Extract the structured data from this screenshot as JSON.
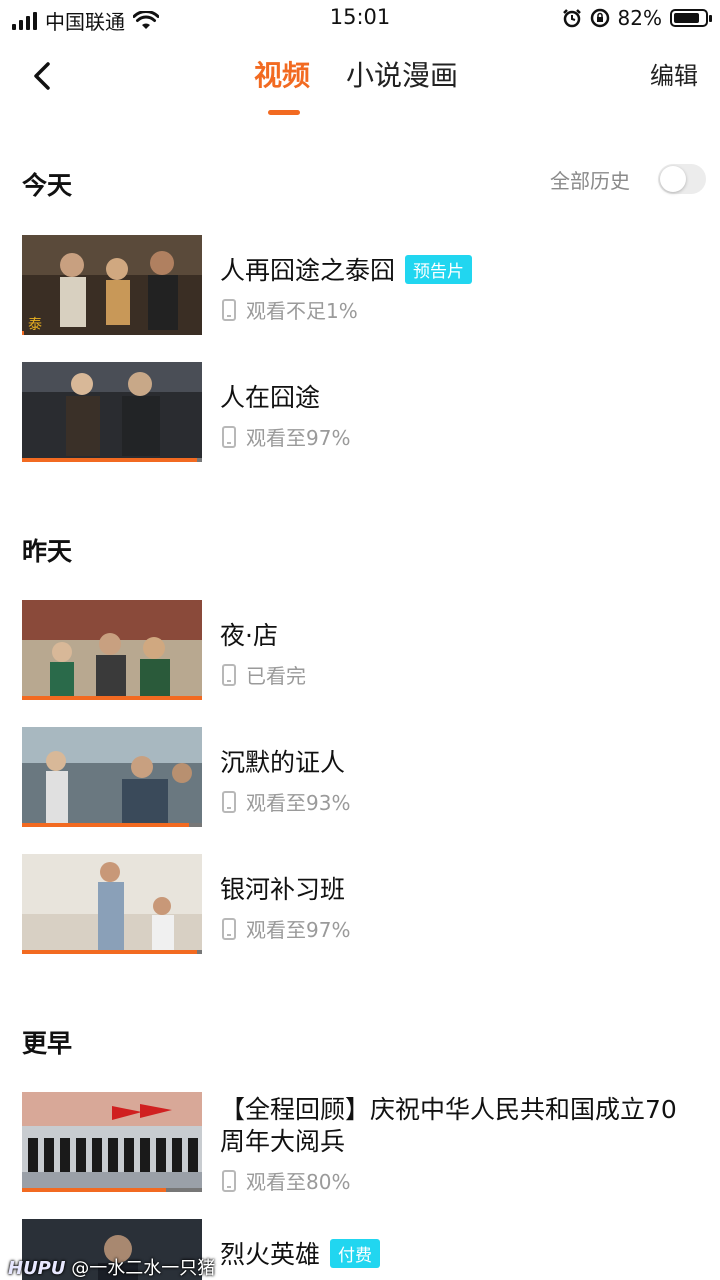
{
  "status_bar": {
    "carrier": "中国联通",
    "time": "15:01",
    "battery_pct": "82%",
    "battery_level": 0.82
  },
  "header": {
    "back_icon": "chevron-left-icon",
    "tabs": [
      {
        "label": "视频",
        "active": true
      },
      {
        "label": "小说漫画",
        "active": false
      }
    ],
    "edit_label": "编辑"
  },
  "history_toggle": {
    "label": "全部历史",
    "on": false
  },
  "sections": {
    "today": {
      "title": "今天",
      "items": [
        {
          "title": "人再囧途之泰囧",
          "badge": "预告片",
          "meta": "观看不足1%",
          "progress": 0.01
        },
        {
          "title": "人在囧途",
          "badge": "",
          "meta": "观看至97%",
          "progress": 0.97
        }
      ]
    },
    "yesterday": {
      "title": "昨天",
      "items": [
        {
          "title": "夜·店",
          "badge": "",
          "meta": "已看完",
          "progress": 1.0
        },
        {
          "title": "沉默的证人",
          "badge": "",
          "meta": "观看至93%",
          "progress": 0.93
        },
        {
          "title": "银河补习班",
          "badge": "",
          "meta": "观看至97%",
          "progress": 0.97
        }
      ]
    },
    "earlier": {
      "title": "更早",
      "items": [
        {
          "title": "【全程回顾】庆祝中华人民共和国成立70周年大阅兵",
          "badge": "",
          "meta": "观看至80%",
          "progress": 0.8
        },
        {
          "title": "烈火英雄",
          "badge": "付费",
          "meta": "",
          "progress": 0
        }
      ]
    }
  },
  "watermark": {
    "brand": "HUPU",
    "text": "@一水二水一只猪"
  },
  "colors": {
    "accent": "#f26a21",
    "badge": "#21d6f0",
    "meta": "#9a9a9a"
  }
}
